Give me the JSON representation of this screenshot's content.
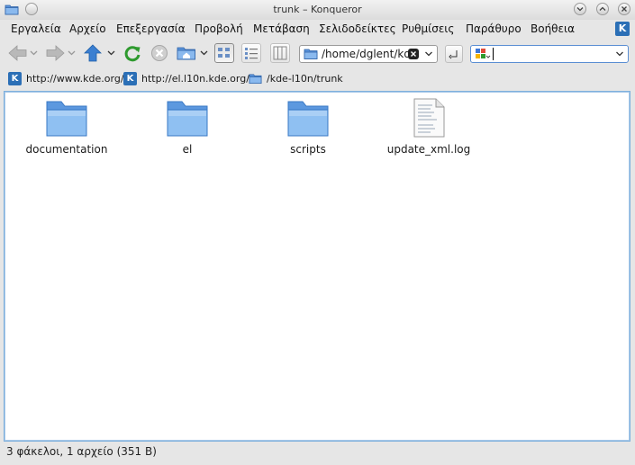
{
  "window": {
    "title": "trunk – Konqueror"
  },
  "menu": [
    {
      "label": "Εργαλεία"
    },
    {
      "label": "Αρχείο"
    },
    {
      "label": "Επεξεργασία"
    },
    {
      "label": "Προβολή"
    },
    {
      "label": "Μετάβαση"
    },
    {
      "label": "Σελιδοδείκτες"
    },
    {
      "label": "Ρυθμίσεις"
    },
    {
      "label": "Παράθυρο"
    },
    {
      "label": "Βοήθεια"
    }
  ],
  "location": {
    "value": "/home/dglent/kde"
  },
  "search": {
    "value": ""
  },
  "bookmarks": [
    {
      "label": "http://www.kde.org/",
      "icon": "kde-icon"
    },
    {
      "label": "http://el.l10n.kde.org/",
      "icon": "kde-icon"
    },
    {
      "label": "/kde-l10n/trunk",
      "icon": "folder-icon"
    }
  ],
  "files": [
    {
      "name": "documentation",
      "type": "folder"
    },
    {
      "name": "el",
      "type": "folder"
    },
    {
      "name": "scripts",
      "type": "folder"
    },
    {
      "name": "update_xml.log",
      "type": "text-file"
    }
  ],
  "status": {
    "text": "3 φάκελοι, 1 αρχείο (351 B)"
  },
  "colors": {
    "accent": "#2b6fb6",
    "folder": "#6ea4e4",
    "selection_border": "#7fb0dd"
  }
}
